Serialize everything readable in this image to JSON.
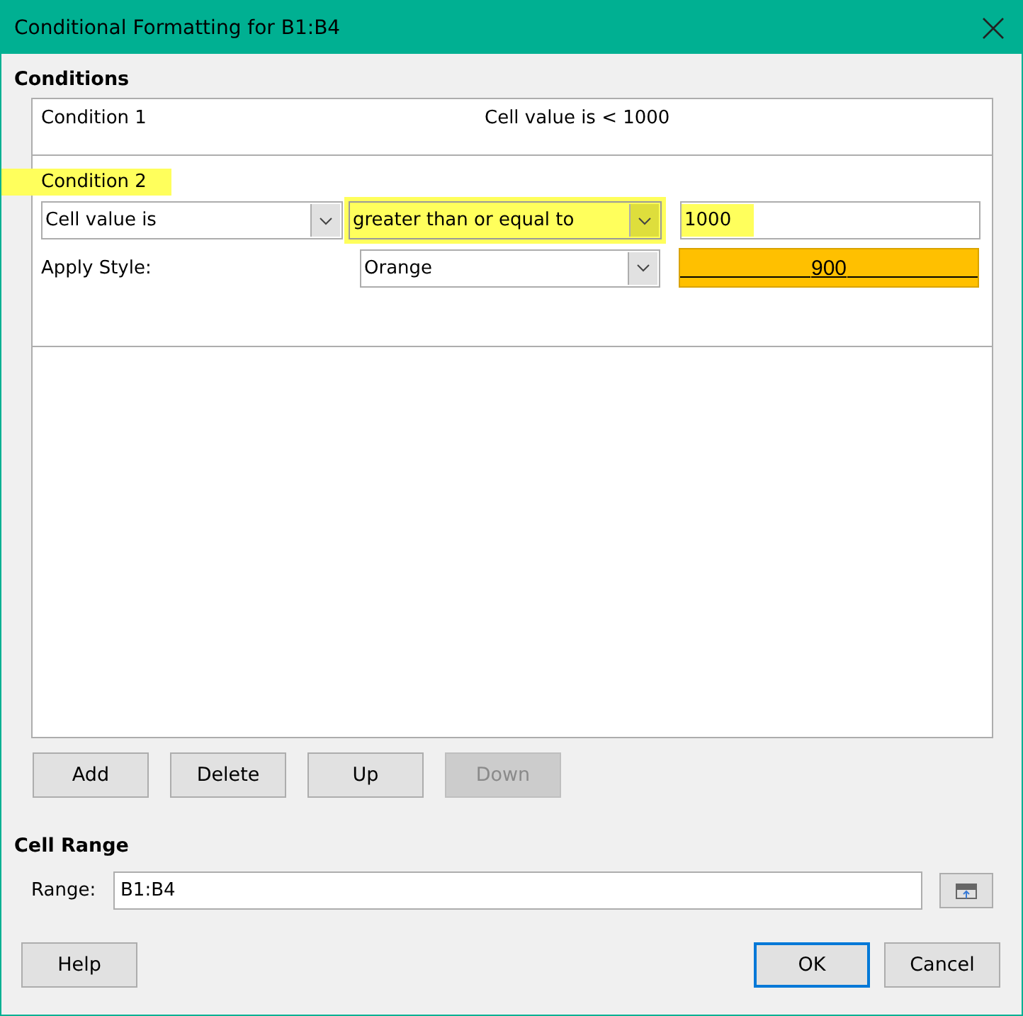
{
  "window": {
    "title": "Conditional Formatting for B1:B4"
  },
  "conditions_heading": "Conditions",
  "conditions": [
    {
      "kind": "collapsed",
      "label": "Condition 1",
      "summary": "Cell value is < 1000"
    },
    {
      "kind": "expanded",
      "label": "Condition 2",
      "label_highlighted": true,
      "type": {
        "value": "Cell value is",
        "highlighted": false
      },
      "operator": {
        "value": "greater than or equal to",
        "highlighted": true
      },
      "value": {
        "value": "1000",
        "highlighted": true
      },
      "style_label": "Apply Style:",
      "style": {
        "value": "Orange"
      },
      "preview": "900"
    }
  ],
  "buttons": [
    {
      "label": "Add",
      "disabled": false
    },
    {
      "label": "Delete",
      "disabled": false
    },
    {
      "label": "Up",
      "disabled": false
    },
    {
      "label": "Down",
      "disabled": true
    }
  ],
  "cell_range": {
    "heading": "Cell Range",
    "label": "Range:",
    "value": "B1:B4"
  },
  "footer": [
    {
      "label": "Help",
      "default": false
    },
    {
      "label": "OK",
      "default": true
    },
    {
      "label": "Cancel",
      "default": false
    }
  ]
}
